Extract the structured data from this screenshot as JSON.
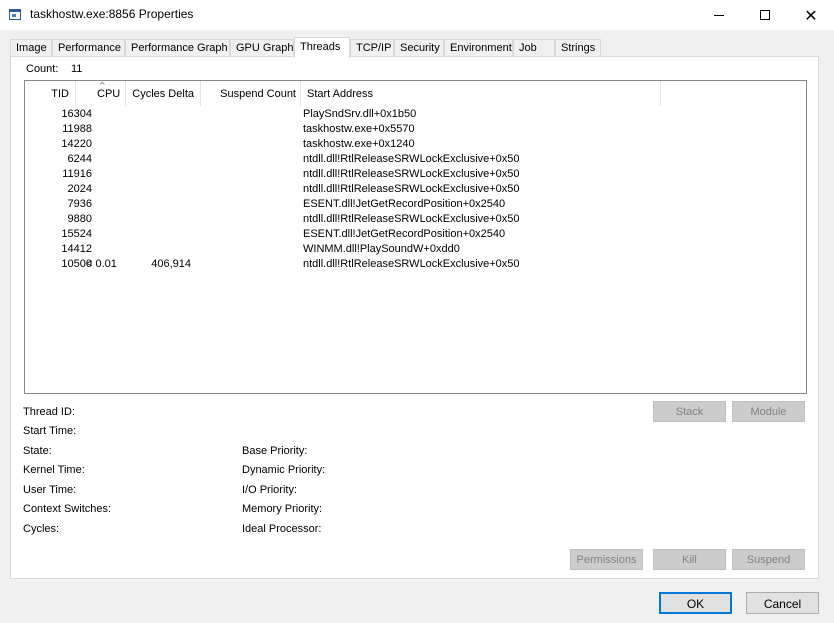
{
  "window": {
    "title": "taskhostw.exe:8856 Properties",
    "minimize_label": "",
    "close_glyph": "✕"
  },
  "tabs": [
    {
      "label": "Image"
    },
    {
      "label": "Performance"
    },
    {
      "label": "Performance Graph"
    },
    {
      "label": "GPU Graph"
    },
    {
      "label": "Threads"
    },
    {
      "label": "TCP/IP"
    },
    {
      "label": "Security"
    },
    {
      "label": "Environment"
    },
    {
      "label": "Job"
    },
    {
      "label": "Strings"
    }
  ],
  "active_tab": "Threads",
  "count": {
    "label": "Count:",
    "value": "11"
  },
  "table": {
    "columns": [
      "TID",
      "CPU",
      "Cycles Delta",
      "Suspend Count",
      "Start Address"
    ],
    "sort_indicator": "^",
    "rows": [
      {
        "tid": "16304",
        "cpu": "",
        "cycles": "",
        "suspend": "",
        "address": "PlaySndSrv.dll+0x1b50"
      },
      {
        "tid": "11988",
        "cpu": "",
        "cycles": "",
        "suspend": "",
        "address": "taskhostw.exe+0x5570"
      },
      {
        "tid": "14220",
        "cpu": "",
        "cycles": "",
        "suspend": "",
        "address": "taskhostw.exe+0x1240"
      },
      {
        "tid": "6244",
        "cpu": "",
        "cycles": "",
        "suspend": "",
        "address": "ntdll.dll!RtlReleaseSRWLockExclusive+0x50"
      },
      {
        "tid": "11916",
        "cpu": "",
        "cycles": "",
        "suspend": "",
        "address": "ntdll.dll!RtlReleaseSRWLockExclusive+0x50"
      },
      {
        "tid": "2024",
        "cpu": "",
        "cycles": "",
        "suspend": "",
        "address": "ntdll.dll!RtlReleaseSRWLockExclusive+0x50"
      },
      {
        "tid": "7936",
        "cpu": "",
        "cycles": "",
        "suspend": "",
        "address": "ESENT.dll!JetGetRecordPosition+0x2540"
      },
      {
        "tid": "9880",
        "cpu": "",
        "cycles": "",
        "suspend": "",
        "address": "ntdll.dll!RtlReleaseSRWLockExclusive+0x50"
      },
      {
        "tid": "15524",
        "cpu": "",
        "cycles": "",
        "suspend": "",
        "address": "ESENT.dll!JetGetRecordPosition+0x2540"
      },
      {
        "tid": "14412",
        "cpu": "",
        "cycles": "",
        "suspend": "",
        "address": "WINMM.dll!PlaySoundW+0xdd0"
      },
      {
        "tid": "10500",
        "cpu": "< 0.01",
        "cycles": "406,914",
        "suspend": "",
        "address": "ntdll.dll!RtlReleaseSRWLockExclusive+0x50"
      }
    ]
  },
  "details": {
    "thread_id": "Thread ID:",
    "start_time": "Start Time:",
    "state": "State:",
    "kernel_time": "Kernel Time:",
    "user_time": "User Time:",
    "context_switches": "Context Switches:",
    "cycles": "Cycles:",
    "base_priority": "Base Priority:",
    "dynamic_priority": "Dynamic Priority:",
    "io_priority": "I/O Priority:",
    "memory_priority": "Memory Priority:",
    "ideal_processor": "Ideal Processor:"
  },
  "buttons": {
    "stack": "Stack",
    "module": "Module",
    "permissions": "Permissions",
    "kill": "Kill",
    "suspend": "Suspend",
    "ok": "OK",
    "cancel": "Cancel"
  }
}
